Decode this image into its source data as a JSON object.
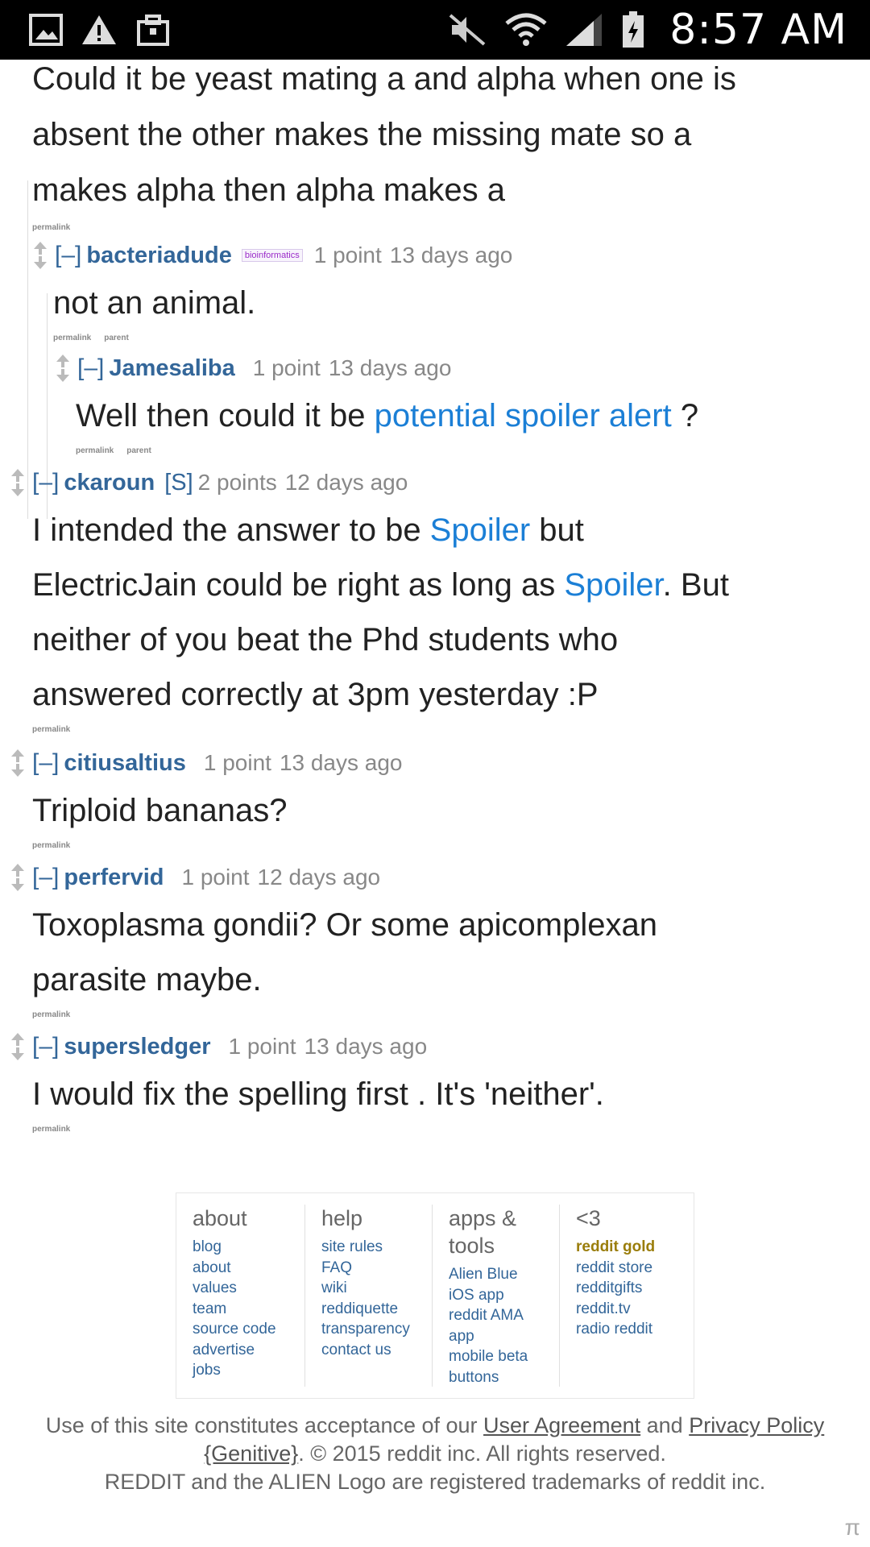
{
  "status_bar": {
    "time": "8:57 AM",
    "icons": [
      "gallery-icon",
      "warning-icon",
      "briefcase-icon",
      "mute-icon",
      "wifi-icon",
      "signal-icon",
      "battery-icon"
    ]
  },
  "top_comment": {
    "body": "Could it be yeast mating a and alpha when one is absent the other makes the missing mate so a makes alpha then alpha makes a",
    "permalink": "permalink"
  },
  "comments": [
    {
      "author": "bacteriadude",
      "flair": "bioinformatics",
      "score": "1 point",
      "time": "13 days ago",
      "body": "not an animal.",
      "links": [
        "permalink",
        "parent"
      ]
    },
    {
      "author": "Jamesaliba",
      "score": "1 point",
      "time": "13 days ago",
      "body_pre": "Well then could it be ",
      "body_link": "potential spoiler alert",
      "body_post": " ?",
      "links": [
        "permalink",
        "parent"
      ]
    },
    {
      "author": "ckaroun",
      "submitter": "S",
      "score": "2 points",
      "time": "12 days ago",
      "body_1": "I intended the answer to be ",
      "body_link1": "Spoiler",
      "body_2": " but ElectricJain could be right as long as ",
      "body_link2": "Spoiler",
      "body_3": ". But neither of you beat the Phd students who answered correctly at 3pm yesterday :P",
      "links": [
        "permalink"
      ]
    },
    {
      "author": "citiusaltius",
      "score": "1 point",
      "time": "13 days ago",
      "body": "Triploid bananas?",
      "links": [
        "permalink"
      ]
    },
    {
      "author": "perfervid",
      "score": "1 point",
      "time": "12 days ago",
      "body": "Toxoplasma gondii? Or some apicomplexan parasite maybe.",
      "links": [
        "permalink"
      ]
    },
    {
      "author": "supersledger",
      "score": "1 point",
      "time": "13 days ago",
      "body": "I would fix the spelling first . It's 'neither'.",
      "links": [
        "permalink"
      ]
    }
  ],
  "collapse_label": "[–]",
  "footer": {
    "columns": [
      {
        "title": "about",
        "items": [
          "blog",
          "about",
          "values",
          "team",
          "source code",
          "advertise",
          "jobs"
        ]
      },
      {
        "title": "help",
        "items": [
          "site rules",
          "FAQ",
          "wiki",
          "reddiquette",
          "transparency",
          "contact us"
        ]
      },
      {
        "title": "apps & tools",
        "items": [
          "Alien Blue iOS app",
          "reddit AMA app",
          "mobile beta",
          "buttons"
        ]
      },
      {
        "title": "<3",
        "items": [
          "reddit gold",
          "reddit store",
          "redditgifts",
          "reddit.tv",
          "radio reddit"
        ]
      }
    ],
    "legal_1": "Use of this site constitutes acceptance of our ",
    "user_agreement": "User Agreement",
    "and": " and ",
    "privacy_policy": "Privacy Policy",
    "genitive": "{Genitive}",
    "legal_2": ". © 2015 reddit inc. All rights reserved.",
    "legal_3": "REDDIT and the ALIEN Logo are registered trademarks of reddit inc.",
    "pi": "π"
  }
}
